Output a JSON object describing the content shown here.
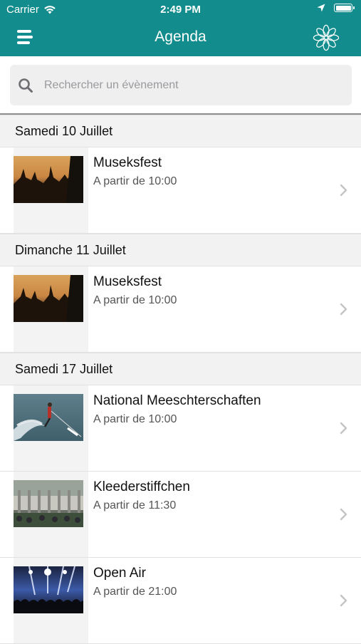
{
  "status_bar": {
    "carrier": "Carrier",
    "time": "2:49 PM"
  },
  "header": {
    "title": "Agenda",
    "menu_icon": "hamburger-menu-icon",
    "logo_icon": "flower-logo-icon",
    "bar_color": "#128C8C"
  },
  "search": {
    "placeholder": "Rechercher un évènement"
  },
  "sections": [
    {
      "date": "Samedi 10 Juillet",
      "events": [
        {
          "title": "Museksfest",
          "time": "A partir de 10:00",
          "image": "concert-crowd-sunset"
        }
      ]
    },
    {
      "date": "Dimanche 11 Juillet",
      "events": [
        {
          "title": "Museksfest",
          "time": "A partir de 10:00",
          "image": "concert-crowd-sunset"
        }
      ]
    },
    {
      "date": "Samedi 17 Juillet",
      "events": [
        {
          "title": "National Meeschterschaften",
          "time": "A partir de 10:00",
          "image": "water-ski"
        },
        {
          "title": "Kleederstiffchen",
          "time": "A partir de 11:30",
          "image": "market-stalls"
        },
        {
          "title": "Open Air",
          "time": "A partir de 21:00",
          "image": "concert-stage-lights"
        }
      ]
    }
  ]
}
